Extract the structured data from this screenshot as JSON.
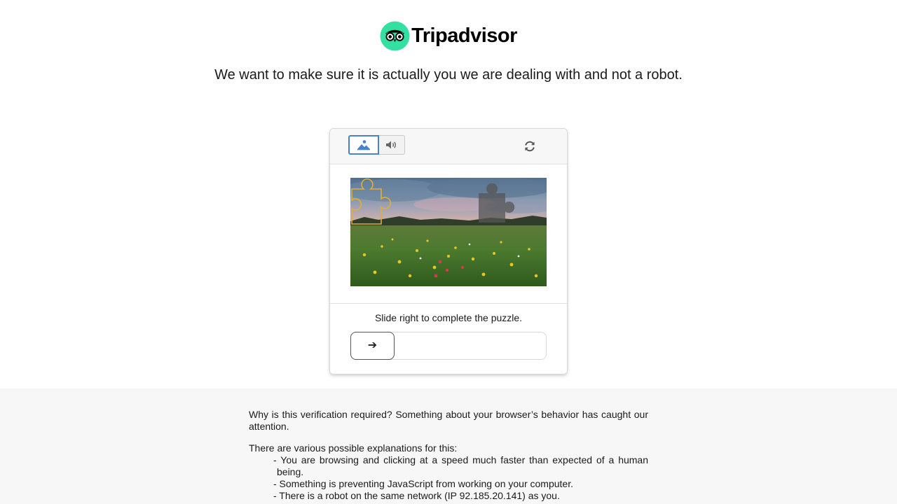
{
  "brand": {
    "name": "Tripadvisor",
    "logo_icon": "tripadvisor-owl-icon",
    "accent_color": "#34e0a1"
  },
  "headline": "We want to make sure it is actually you we are dealing with and not a robot.",
  "captcha": {
    "modes": [
      {
        "name": "image",
        "icon": "image-icon",
        "selected": true
      },
      {
        "name": "audio",
        "icon": "speaker-icon",
        "selected": false
      }
    ],
    "refresh_icon": "refresh-icon",
    "instruction": "Slide right to complete the puzzle.",
    "slider_icon": "arrow-right-icon",
    "slider_arrow": "➔",
    "slider_progress": 0
  },
  "explanation": {
    "intro": "Why is this verification required? Something about your browser’s behavior has caught our attention.",
    "causes_title": "There are various possible explanations for this:",
    "causes": [
      "- You are browsing and clicking at a speed much faster than expected of a human being.",
      "- Something is preventing JavaScript from working on your computer.",
      "- There is a robot on the same network (IP 92.185.20.141) as you."
    ]
  }
}
